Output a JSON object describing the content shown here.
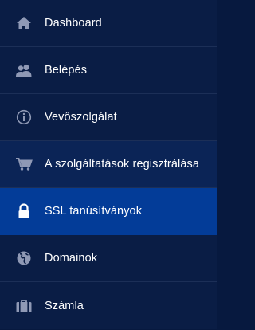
{
  "menu": {
    "items": [
      {
        "label": "Dashboard",
        "icon": "home-icon"
      },
      {
        "label": "Belépés",
        "icon": "users-icon"
      },
      {
        "label": "Vevőszolgálat",
        "icon": "info-icon"
      },
      {
        "label": "A szolgáltatások regisztrálása",
        "icon": "cart-icon"
      },
      {
        "label": "SSL tanúsítványok",
        "icon": "lock-icon"
      },
      {
        "label": "Domainok",
        "icon": "globe-icon"
      },
      {
        "label": "Számla",
        "icon": "briefcase-icon"
      }
    ],
    "active_index": 4,
    "hover_index": 3
  },
  "colors": {
    "background": "#0a1d45",
    "hover": "#0b2456",
    "active": "#033c98",
    "icon": "#8f99b5",
    "text": "#ffffff"
  }
}
